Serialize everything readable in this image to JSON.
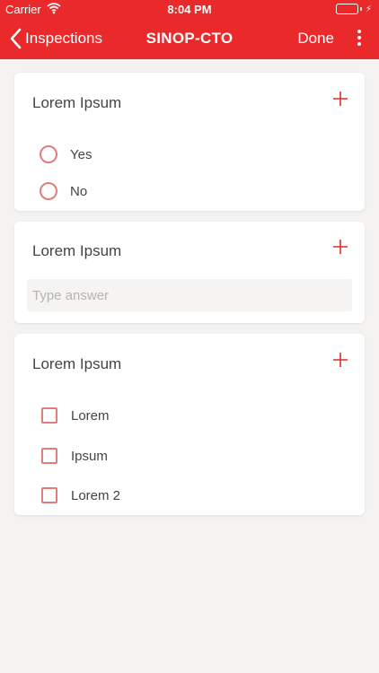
{
  "status": {
    "carrier": "Carrier",
    "time": "8:04 PM"
  },
  "nav": {
    "back_label": "Inspections",
    "title": "SINOP-CTO",
    "done_label": "Done"
  },
  "colors": {
    "header": "#ea2a2a",
    "accent": "#e37c7c",
    "background": "#f4f3f1"
  },
  "questions": [
    {
      "title": "Lorem Ipsum",
      "type": "radio",
      "options": [
        "Yes",
        "No"
      ]
    },
    {
      "title": "Lorem Ipsum",
      "type": "text",
      "placeholder": "Type answer",
      "value": ""
    },
    {
      "title": "Lorem Ipsum",
      "type": "checkbox",
      "options": [
        "Lorem",
        "Ipsum",
        "Lorem 2"
      ]
    }
  ]
}
